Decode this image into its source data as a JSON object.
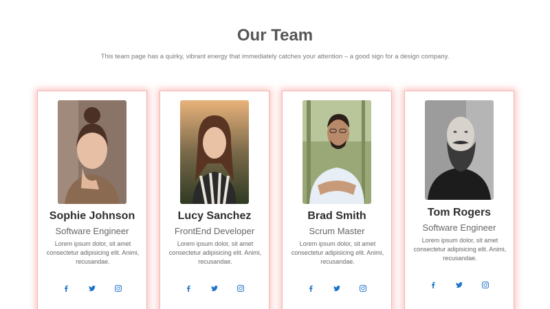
{
  "header": {
    "title": "Our Team",
    "subtitle": "This team page has a quirky, vibrant energy that immediately catches your attention – a good sign for a design company."
  },
  "members": [
    {
      "name": "Sophie Johnson",
      "role": "Software Engineer",
      "description": "Lorem ipsum dolor, sit amet consectetur adipisicing elit. Animi, recusandae.",
      "photo_icon": "portrait-woman-photo"
    },
    {
      "name": "Lucy Sanchez",
      "role": "FrontEnd Developer",
      "description": "Lorem ipsum dolor, sit amet consectetur adipisicing elit. Animi, recusandae.",
      "photo_icon": "portrait-woman-photo"
    },
    {
      "name": "Brad Smith",
      "role": "Scrum Master",
      "description": "Lorem ipsum dolor, sit amet consectetur adipisicing elit. Animi, recusandae.",
      "photo_icon": "portrait-man-photo"
    },
    {
      "name": "Tom Rogers",
      "role": "Software Engineer",
      "description": "Lorem ipsum dolor, sit amet consectetur adipisicing elit. Animi, recusandae.",
      "photo_icon": "portrait-man-photo"
    }
  ],
  "social_icons": [
    "facebook-icon",
    "twitter-icon",
    "instagram-icon"
  ],
  "colors": {
    "accent": "#1a73c8",
    "card_glow": "#f4827c",
    "title": "#555555"
  }
}
